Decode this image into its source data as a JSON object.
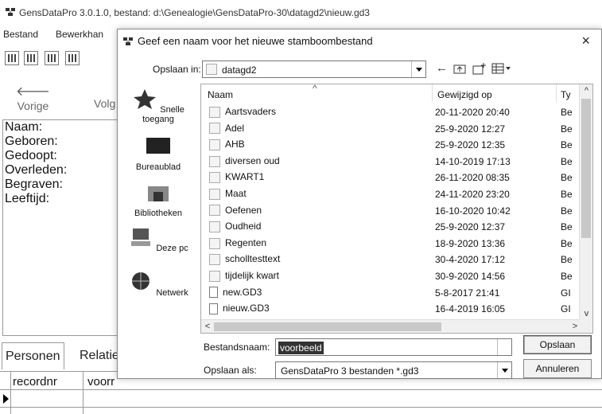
{
  "window": {
    "title": "GensDataPro 3.0.1.0, bestand: d:\\Genealogie\\GensDataPro-30\\datagd2\\nieuw.gd3"
  },
  "menu": [
    "Bestand",
    "Bewerkhan"
  ],
  "nav": {
    "back": "Vorige",
    "forward": "Volg"
  },
  "info_fields": [
    "Naam:",
    "Geboren:",
    "Gedoopt:",
    "Overleden:",
    "Begraven:",
    "Leeftijd:"
  ],
  "tabs": [
    "Personen",
    "Relatie"
  ],
  "grid_columns": [
    "recordnr",
    "voorr"
  ],
  "dialog": {
    "title": "Geef een naam voor het nieuwe stamboombestand",
    "close": "×",
    "save_in_label": "Opslaan in:",
    "save_in_value": "datagd2",
    "places": [
      "Snelle toegang",
      "Bureaublad",
      "Bibliotheken",
      "Deze pc",
      "Netwerk"
    ],
    "columns": {
      "name": "Naam",
      "modified": "Gewijzigd op",
      "type": "Ty"
    },
    "files": [
      {
        "name": "Aartsvaders",
        "date": "20-11-2020 20:40",
        "type": "Be",
        "kind": "folder"
      },
      {
        "name": "Adel",
        "date": "25-9-2020 12:27",
        "type": "Be",
        "kind": "folder"
      },
      {
        "name": "AHB",
        "date": "25-9-2020 12:35",
        "type": "Be",
        "kind": "folder"
      },
      {
        "name": "diversen oud",
        "date": "14-10-2019 17:13",
        "type": "Be",
        "kind": "folder"
      },
      {
        "name": "KWART1",
        "date": "26-11-2020 08:35",
        "type": "Be",
        "kind": "folder"
      },
      {
        "name": "Maat",
        "date": "24-11-2020 23:20",
        "type": "Be",
        "kind": "folder"
      },
      {
        "name": "Oefenen",
        "date": "16-10-2020 10:42",
        "type": "Be",
        "kind": "folder"
      },
      {
        "name": "Oudheid",
        "date": "25-9-2020 12:37",
        "type": "Be",
        "kind": "folder"
      },
      {
        "name": "Regenten",
        "date": "18-9-2020 13:36",
        "type": "Be",
        "kind": "folder"
      },
      {
        "name": "scholltesttext",
        "date": "30-4-2020 17:12",
        "type": "Be",
        "kind": "folder"
      },
      {
        "name": "tijdelijk kwart",
        "date": "30-9-2020 14:56",
        "type": "Be",
        "kind": "folder"
      },
      {
        "name": "new.GD3",
        "date": "5-8-2017 21:41",
        "type": "GI",
        "kind": "file"
      },
      {
        "name": "nieuw.GD3",
        "date": "16-4-2019 16:05",
        "type": "GI",
        "kind": "file"
      }
    ],
    "filename_label": "Bestandsnaam:",
    "filename_value": "voorbeeld",
    "saveas_label": "Opslaan als:",
    "saveas_value": "GensDataPro 3 bestanden *.gd3",
    "save_button": "Opslaan",
    "cancel_button": "Annuleren"
  }
}
